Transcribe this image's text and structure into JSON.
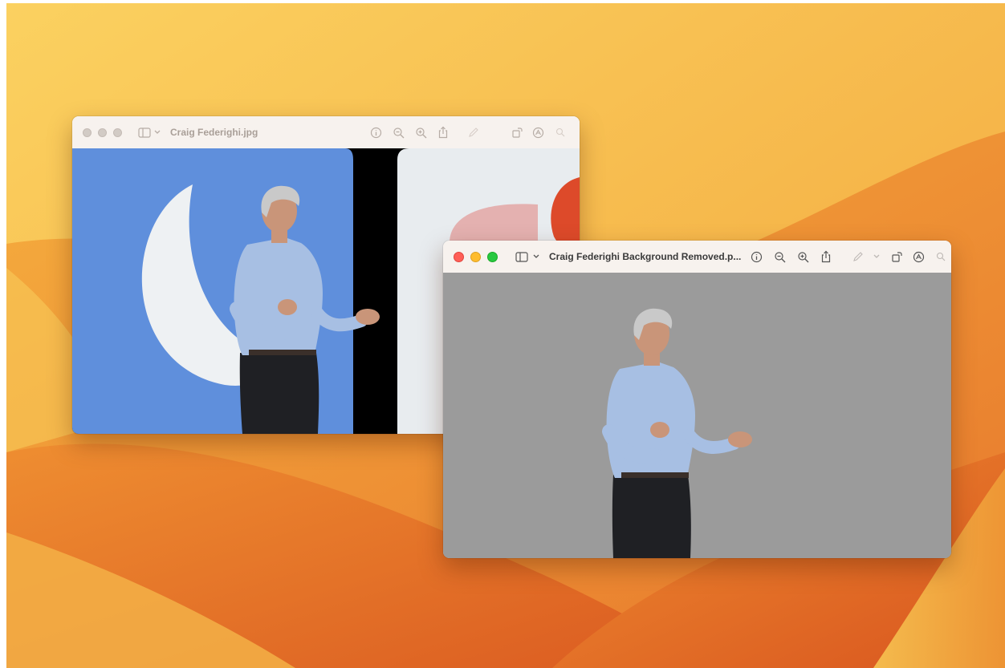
{
  "desktop": {
    "wallpaper": "macos-ventura-orange"
  },
  "colors": {
    "wallpaper_light": "#f8c24a",
    "wallpaper_dark": "#df5f24",
    "preview_gray": "#9b9b9b",
    "stage_blue": "#5f8fdc"
  },
  "window_original": {
    "title": "Craig Federighi.jpg",
    "focused": false,
    "icons": [
      "sidebar-icon",
      "chevron-down-icon",
      "info-icon",
      "zoom-out-icon",
      "zoom-in-icon",
      "share-icon",
      "markup-pen-icon",
      "rotate-icon",
      "markup-circle-icon",
      "search-icon"
    ]
  },
  "window_removed": {
    "title": "Craig Federighi Background Removed.p...",
    "focused": true,
    "icons": [
      "sidebar-icon",
      "chevron-down-icon",
      "info-icon",
      "zoom-out-icon",
      "zoom-in-icon",
      "share-icon",
      "markup-pen-icon",
      "chevron-down-icon",
      "rotate-icon",
      "markup-circle-icon",
      "search-icon"
    ]
  }
}
